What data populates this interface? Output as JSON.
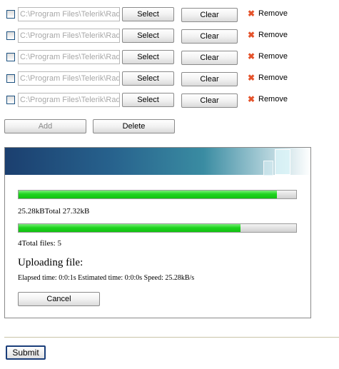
{
  "upload_rows": [
    {
      "path": "C:\\Program Files\\Telerik\\RadC",
      "select_label": "Select",
      "clear_label": "Clear",
      "remove_label": "Remove"
    },
    {
      "path": "C:\\Program Files\\Telerik\\RadC",
      "select_label": "Select",
      "clear_label": "Clear",
      "remove_label": "Remove"
    },
    {
      "path": "C:\\Program Files\\Telerik\\RadC",
      "select_label": "Select",
      "clear_label": "Clear",
      "remove_label": "Remove"
    },
    {
      "path": "C:\\Program Files\\Telerik\\RadC",
      "select_label": "Select",
      "clear_label": "Clear",
      "remove_label": "Remove"
    },
    {
      "path": "C:\\Program Files\\Telerik\\RadC",
      "select_label": "Select",
      "clear_label": "Clear",
      "remove_label": "Remove"
    }
  ],
  "actions": {
    "add_label": "Add",
    "delete_label": "Delete"
  },
  "progress_area": {
    "bytes_progress_fraction": 0.93,
    "bytes_text": "25.28kBTotal 27.32kB",
    "files_progress_fraction": 0.8,
    "files_text": "4Total files: 5",
    "status_heading": "Uploading file:",
    "timing_text": "Elapsed time: 0:0:1s Estimated time: 0:0:0s Speed: 25.28kB/s",
    "cancel_label": "Cancel"
  },
  "form": {
    "submit_label": "Submit"
  },
  "colors": {
    "progress_green": "#1fd41f",
    "header_blue": "#1b3f6f",
    "remove_icon": "#e5532b"
  },
  "icons": {
    "remove": "close-x-icon",
    "header_art": "documents-icon"
  }
}
